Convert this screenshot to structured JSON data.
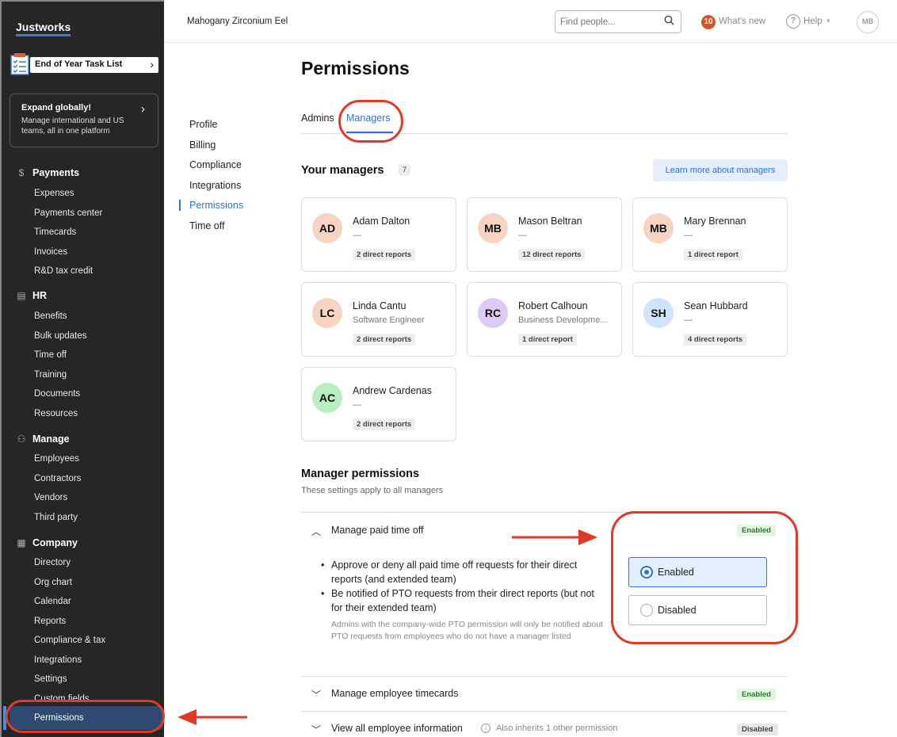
{
  "sidebar": {
    "logo": "Justworks",
    "task_list": "End of Year Task List",
    "promo": {
      "title": "Expand globally!",
      "desc": "Manage international and US teams, all in one platform"
    },
    "sections": [
      {
        "label": "Payments",
        "icon": "dollar-icon",
        "items": [
          "Expenses",
          "Payments center",
          "Timecards",
          "Invoices",
          "R&D tax credit"
        ]
      },
      {
        "label": "HR",
        "icon": "clipboard-icon",
        "items": [
          "Benefits",
          "Bulk updates",
          "Time off",
          "Training",
          "Documents",
          "Resources"
        ]
      },
      {
        "label": "Manage",
        "icon": "people-icon",
        "items": [
          "Employees",
          "Contractors",
          "Vendors",
          "Third party"
        ]
      },
      {
        "label": "Company",
        "icon": "building-icon",
        "items": [
          "Directory",
          "Org chart",
          "Calendar",
          "Reports",
          "Compliance & tax",
          "Integrations",
          "Settings",
          "Custom fields",
          "Permissions"
        ]
      }
    ]
  },
  "header": {
    "company": "Mahogany Zirconium Eel",
    "search_placeholder": "Find people...",
    "whats_new_count": "10",
    "whats_new": "What's new",
    "help": "Help",
    "user_initials": "MB"
  },
  "page": {
    "title": "Permissions",
    "subnav": [
      "Profile",
      "Billing",
      "Compliance",
      "Integrations",
      "Permissions",
      "Time off"
    ],
    "tabs": [
      "Admins",
      "Managers"
    ],
    "your_managers": "Your managers",
    "manager_count": "7",
    "learn_more": "Learn more about managers",
    "managers": [
      {
        "initials": "AD",
        "name": "Adam Dalton",
        "title": "—",
        "reports": "2 direct reports",
        "color": "#f7d3c2"
      },
      {
        "initials": "MB",
        "name": "Mason Beltran",
        "title": "—",
        "reports": "12 direct reports",
        "color": "#f7d3c2"
      },
      {
        "initials": "MB",
        "name": "Mary Brennan",
        "title": "—",
        "reports": "1 direct report",
        "color": "#f7d3c2"
      },
      {
        "initials": "LC",
        "name": "Linda Cantu",
        "title": "Software Engineer",
        "reports": "2 direct reports",
        "color": "#f7d3c2"
      },
      {
        "initials": "RC",
        "name": "Robert Calhoun",
        "title": "Business Developme...",
        "reports": "1 direct report",
        "color": "#dccbf6"
      },
      {
        "initials": "SH",
        "name": "Sean Hubbard",
        "title": "—",
        "reports": "4 direct reports",
        "color": "#cfe3fb"
      },
      {
        "initials": "AC",
        "name": "Andrew Cardenas",
        "title": "—",
        "reports": "2 direct reports",
        "color": "#b9efc0"
      }
    ],
    "manager_permissions": {
      "title": "Manager permissions",
      "subtitle": "These settings apply to all managers",
      "pto": {
        "title": "Manage paid time off",
        "status": "Enabled",
        "bullets": [
          "Approve or deny all paid time off requests for their direct reports (and extended team)",
          "Be notified of PTO requests from their direct reports (but not for their extended team)"
        ],
        "note": "Admins with the company-wide PTO permission will only be notified about PTO requests from employees who do not have a manager listed",
        "options": [
          "Enabled",
          "Disabled"
        ],
        "selected": "Enabled"
      },
      "timecards": {
        "title": "Manage employee timecards",
        "status": "Enabled"
      },
      "employee_info": {
        "title": "View all employee information",
        "inherit_note": "Also inherits 1 other permission",
        "status": "Disabled"
      }
    }
  },
  "colors": {
    "accent": "#2f6fd6",
    "annotation": "#e03a26",
    "sidebar_bg": "#262626"
  }
}
